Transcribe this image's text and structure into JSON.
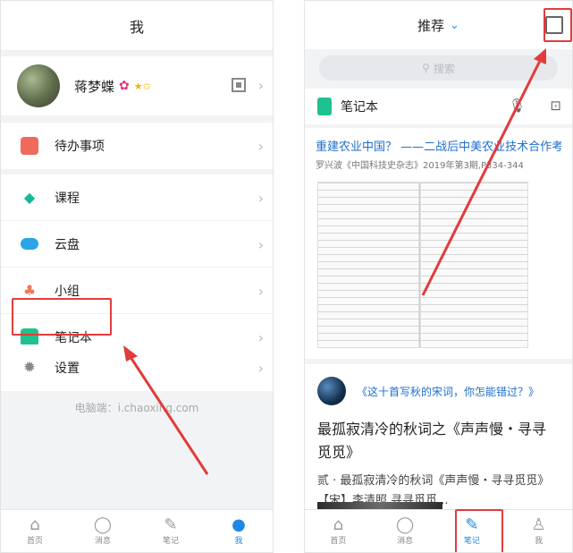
{
  "left": {
    "title": "我",
    "profile": {
      "name": "蒋梦蝶",
      "badge_icon": "flower-badge-icon",
      "stars": "★✩"
    },
    "groups": [
      [
        {
          "label": "待办事项",
          "icon": "todo-icon",
          "color": "#f06a5a"
        }
      ],
      [
        {
          "label": "课程",
          "icon": "graduation-cap-icon",
          "color": "#17b896"
        },
        {
          "label": "云盘",
          "icon": "cloud-icon",
          "color": "#2aa3e8"
        },
        {
          "label": "小组",
          "icon": "group-icon",
          "color": "#f2775a"
        },
        {
          "label": "笔记本",
          "icon": "notebook-icon",
          "color": "#1ec18f"
        }
      ],
      [
        {
          "label": "设置",
          "icon": "gear-icon",
          "color": "#888888"
        }
      ]
    ],
    "footer_hint": "电脑端：i.chaoxing.com",
    "tabs": [
      {
        "label": "首页",
        "icon": "home-icon",
        "glyph": "⌂"
      },
      {
        "label": "消息",
        "icon": "message-icon",
        "glyph": "◯"
      },
      {
        "label": "笔记",
        "icon": "note-icon",
        "glyph": "✎"
      },
      {
        "label": "我",
        "icon": "user-icon",
        "glyph": "●",
        "active": true
      }
    ]
  },
  "right": {
    "title": "推荐",
    "dropdown_icon": "chevron-down-icon",
    "search_placeholder": "搜索",
    "notebook_label": "笔记本",
    "card1": {
      "title": "重建农业中国？ ——二战后中美农业技术合作考察…",
      "subtitle": "罗兴波《中国科技史杂志》2019年第3期,P334-344"
    },
    "card2": {
      "quote": "《这十首写秋的宋词，你怎能错过？》",
      "title": "最孤寂清冷的秋词之《声声慢・寻寻觅觅》",
      "body": "贰 · 最孤寂清冷的秋词《声声慢・寻寻觅觅》【宋】李清照 寻寻觅觅..."
    },
    "tabs": [
      {
        "label": "首页",
        "icon": "home-icon",
        "glyph": "⌂"
      },
      {
        "label": "消息",
        "icon": "message-icon",
        "glyph": "◯"
      },
      {
        "label": "笔记",
        "icon": "note-icon",
        "glyph": "✎",
        "active": true
      },
      {
        "label": "我",
        "icon": "user-icon",
        "glyph": "♙"
      }
    ]
  },
  "accent_color": "#1e88e5",
  "highlight_color": "#e23b3b"
}
